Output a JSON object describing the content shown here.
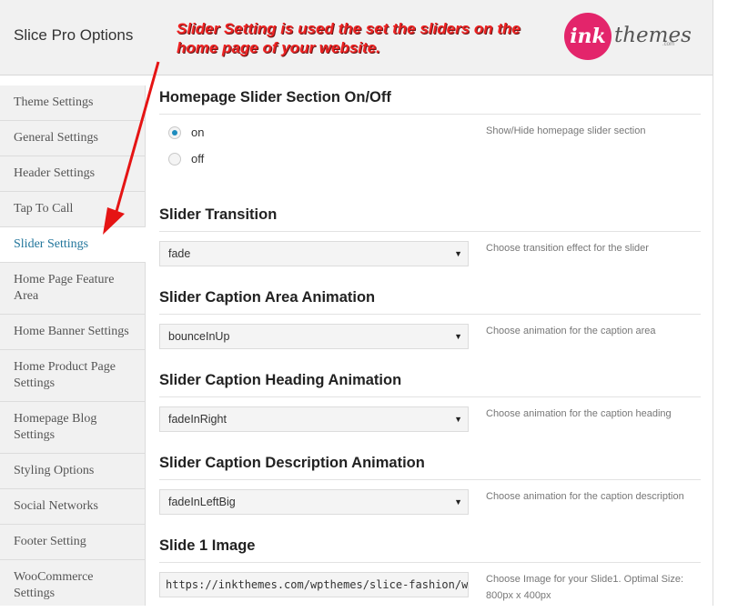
{
  "app": {
    "title": "Slice Pro Options",
    "annotation": "Slider Setting is used the set the sliders on the home page of your website.",
    "logo": {
      "mark": "ink",
      "word": "themes",
      "sub": ".com",
      "color": "#e3256b"
    }
  },
  "sidebar": {
    "items": [
      {
        "label": "Theme Settings"
      },
      {
        "label": "General Settings"
      },
      {
        "label": "Header Settings"
      },
      {
        "label": "Tap To Call"
      },
      {
        "label": "Slider Settings",
        "active": true
      },
      {
        "label": "Home Page Feature Area"
      },
      {
        "label": "Home Banner Settings"
      },
      {
        "label": "Home Product Page Settings"
      },
      {
        "label": "Homepage Blog Settings"
      },
      {
        "label": "Styling Options"
      },
      {
        "label": "Social Networks"
      },
      {
        "label": "Footer Setting"
      },
      {
        "label": "WooCommerce Settings"
      }
    ]
  },
  "sections": {
    "onoff": {
      "title": "Homepage Slider Section On/Off",
      "options": [
        "on",
        "off"
      ],
      "selected": "on",
      "desc": "Show/Hide homepage slider section"
    },
    "transition": {
      "title": "Slider Transition",
      "value": "fade",
      "desc": "Choose transition effect for the slider"
    },
    "caption_area": {
      "title": "Slider Caption Area Animation",
      "value": "bounceInUp",
      "desc": "Choose animation for the caption area"
    },
    "caption_heading": {
      "title": "Slider Caption Heading Animation",
      "value": "fadeInRight",
      "desc": "Choose animation for the caption heading"
    },
    "caption_desc": {
      "title": "Slider Caption Description Animation",
      "value": "fadeInLeftBig",
      "desc": "Choose animation for the caption description"
    },
    "slide1": {
      "title": "Slide 1 Image",
      "value": "https://inkthemes.com/wpthemes/slice-fashion/wp-content/",
      "desc": "Choose Image for your Slide1. Optimal Size: 800px x 400px"
    }
  },
  "colors": {
    "accent": "#21759b",
    "annotation": "#ee2222",
    "radio": "#1e8cbe"
  }
}
